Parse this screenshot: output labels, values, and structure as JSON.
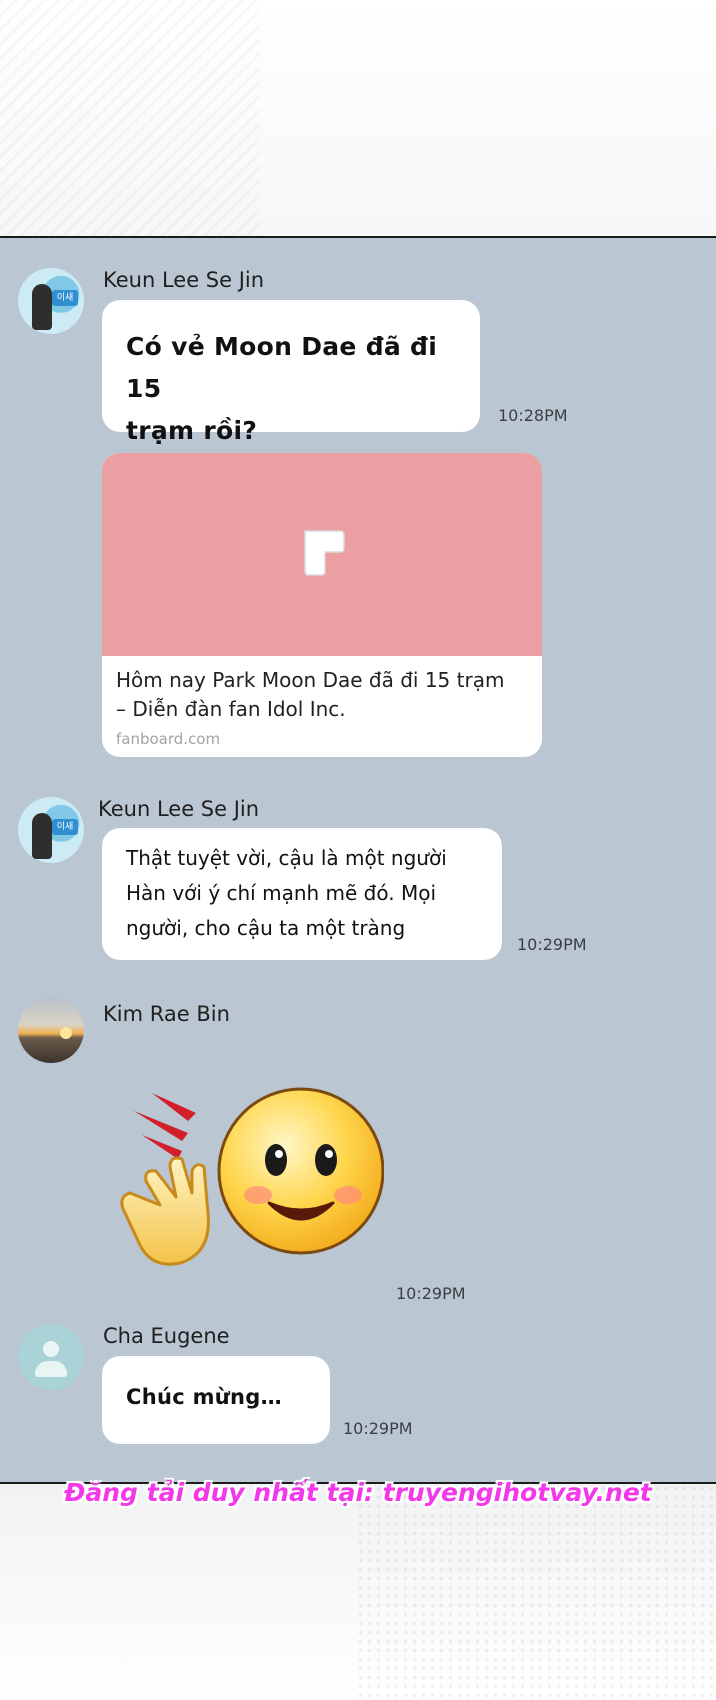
{
  "messages": [
    {
      "sender": "Keun Lee Se Jin",
      "text": "Có vẻ Moon Dae đã đi 15\ntrạm rồi?",
      "time": "10:28PM"
    },
    {
      "link": {
        "title": "Hôm nay Park Moon Dae đã đi 15 trạm\n– Diễn đàn fan Idol Inc.",
        "domain": "fanboard.com",
        "preview_color": "#eb9fa2",
        "icon": "fanboard-logo-icon"
      }
    },
    {
      "sender": "Keun Lee Se Jin",
      "text": "Thật tuyệt vời, cậu là một người\nHàn với ý chí mạnh mẽ đó. Mọi\nngười, cho cậu ta một tràng",
      "time": "10:29PM"
    },
    {
      "sender": "Kim Rae Bin",
      "sticker": "clapping-smiley-sticker",
      "time": "10:29PM"
    },
    {
      "sender": "Cha Eugene",
      "text": "Chúc mừng…",
      "time": "10:29PM"
    }
  ],
  "watermark": "Đăng tải duy nhất tại: truyengihotvay.net",
  "colors": {
    "chat_background": "#bac6d2",
    "bubble": "#ffffff",
    "watermark": "#f238e8"
  }
}
